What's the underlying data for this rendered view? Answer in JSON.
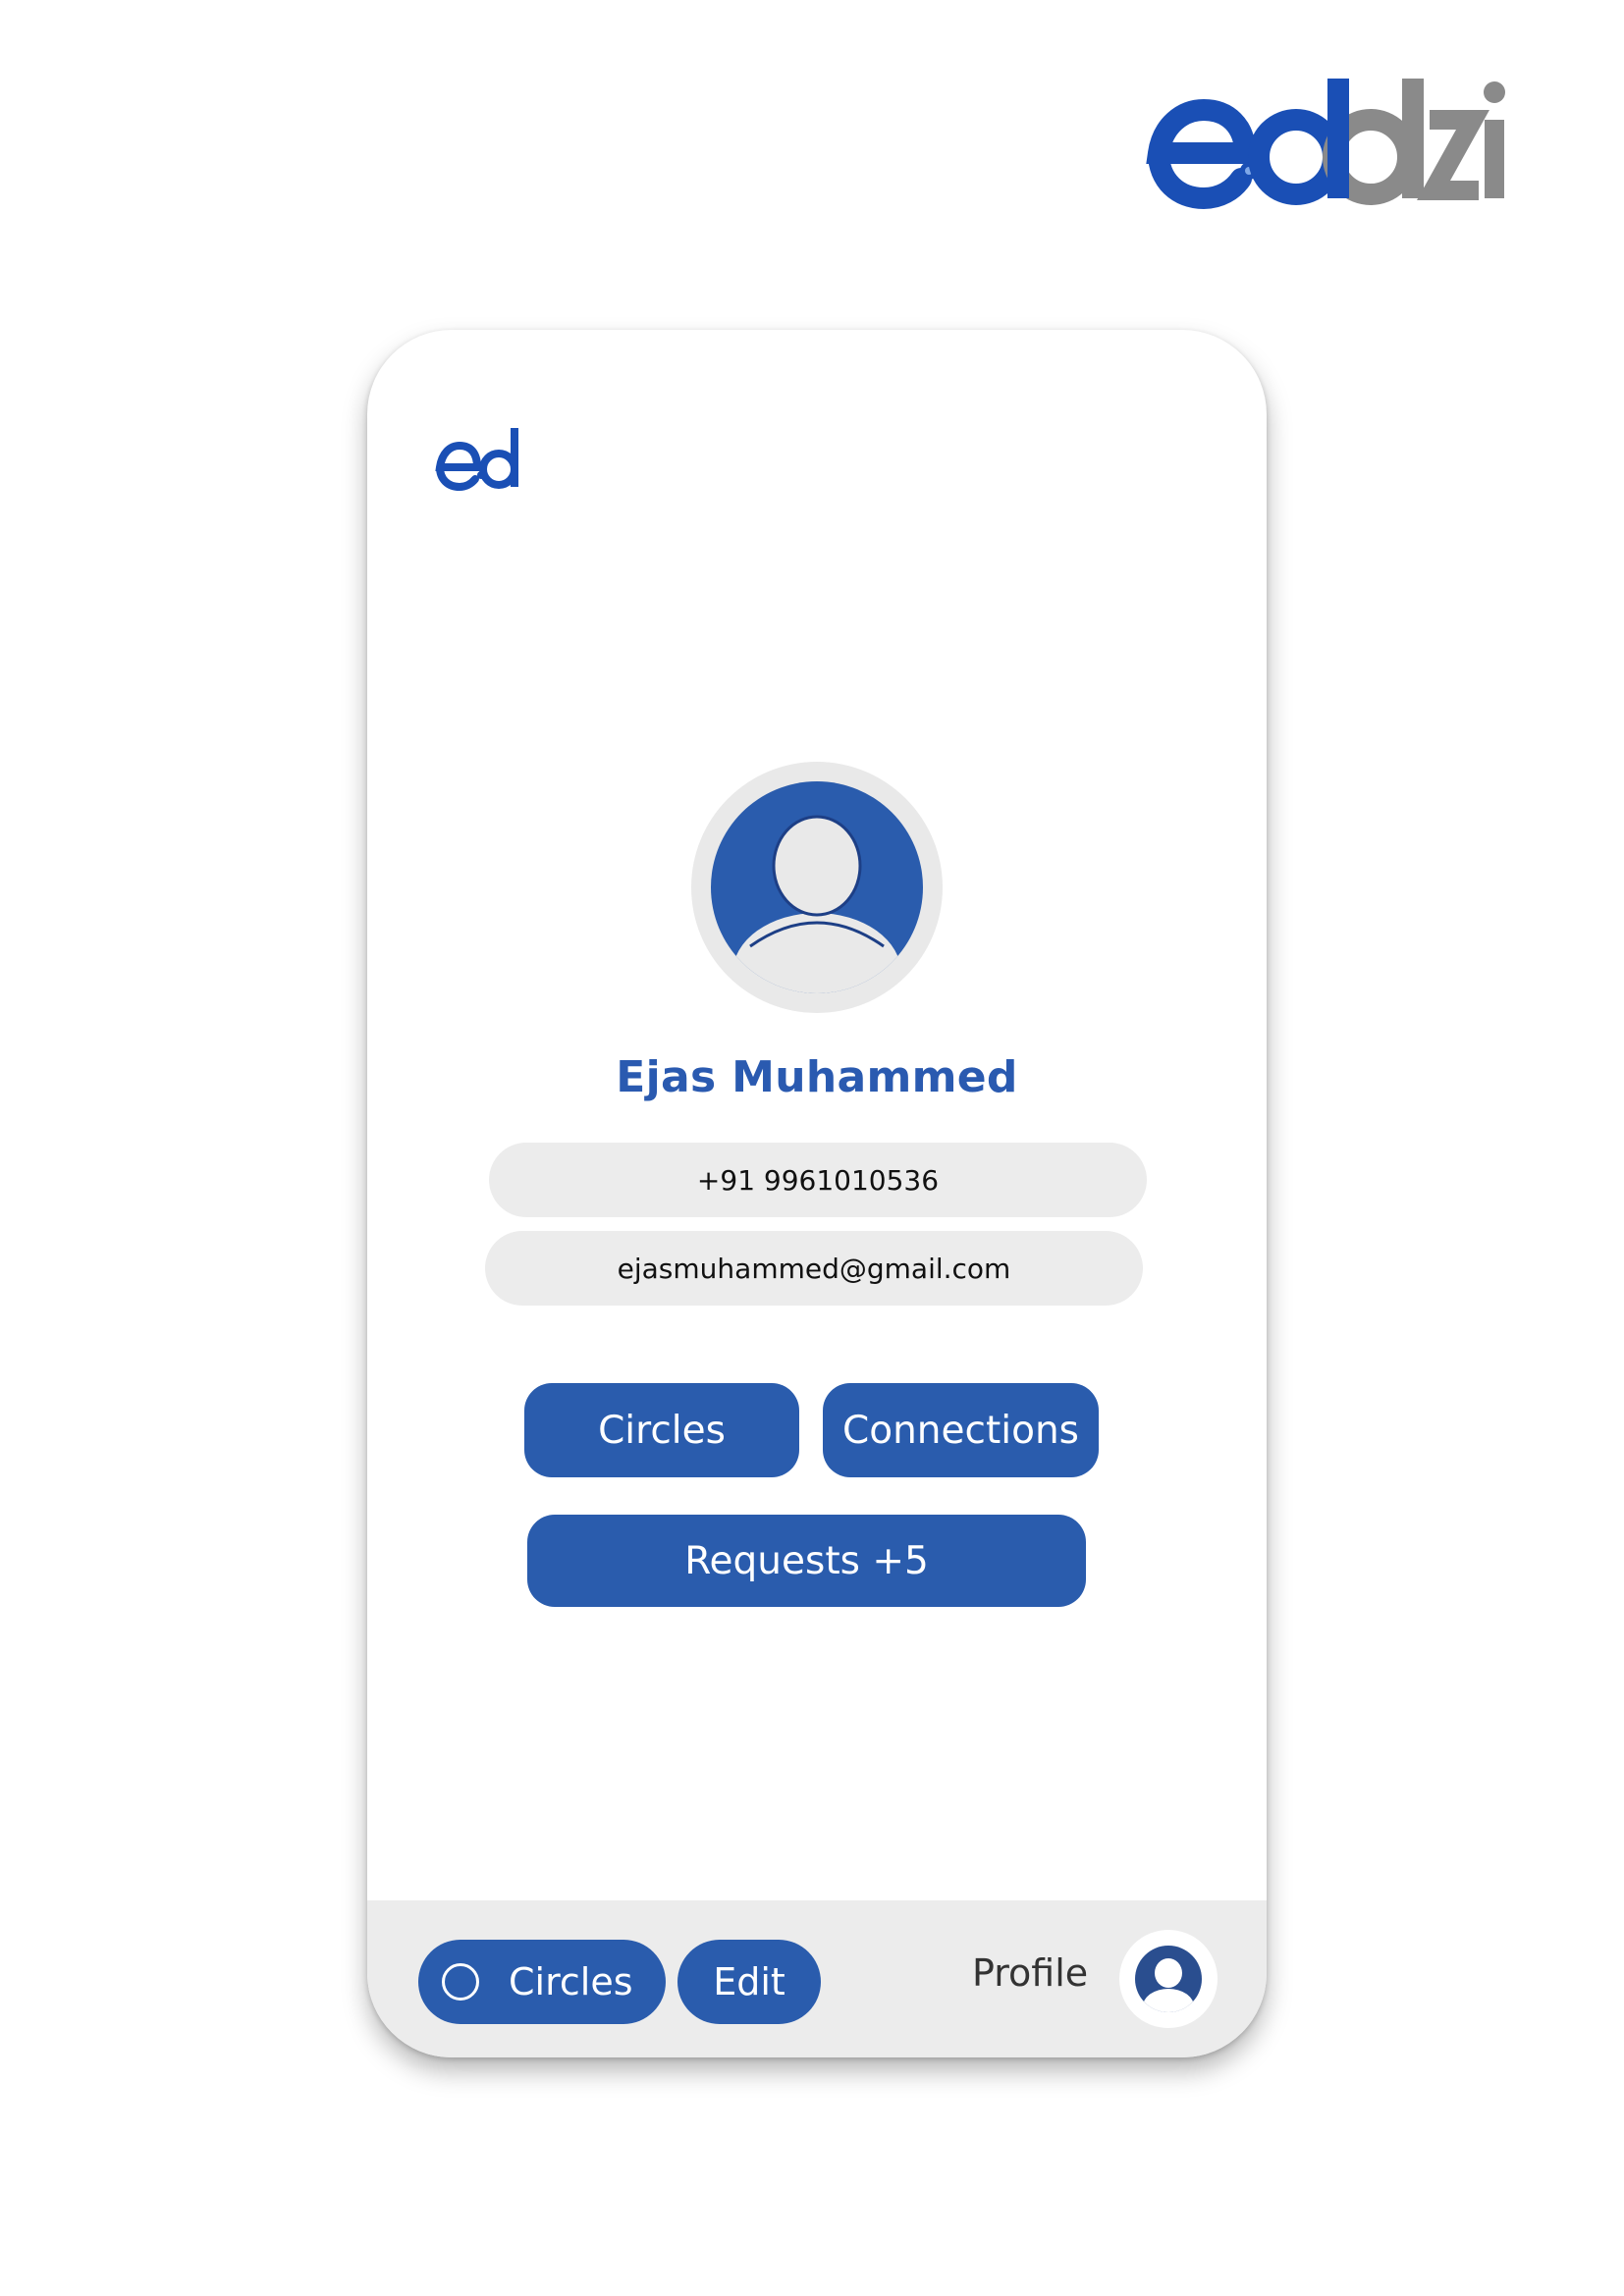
{
  "brand": {
    "accent": "#2a5cad",
    "logo_mark_blue": "#1a4fb5",
    "logo_mark_gray": "#8a8a8a"
  },
  "profile": {
    "name": "Ejas Muhammed",
    "phone": "+91 9961010536",
    "email": "ejasmuhammed@gmail.com"
  },
  "actions": {
    "circles_label": "Circles",
    "connections_label": "Connections",
    "requests_label": "Requests +5"
  },
  "bottom_nav": {
    "circles_label": "Circles",
    "edit_label": "Edit",
    "profile_label": "Profile"
  },
  "icons": [
    "eddzi-logo",
    "ed-logo",
    "avatar-icon",
    "circle-icon",
    "profile-avatar-icon"
  ]
}
